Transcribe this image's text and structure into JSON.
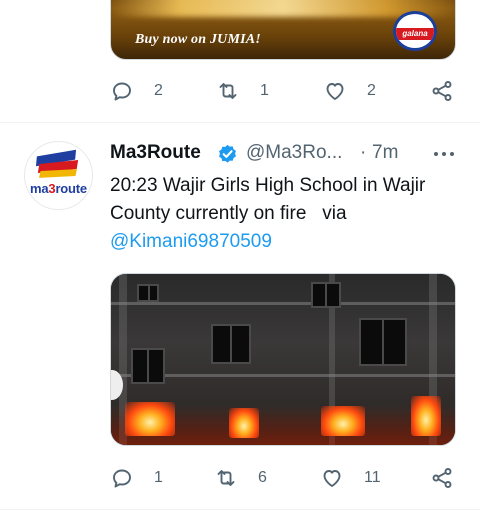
{
  "previous_tweet": {
    "media": {
      "promo_text": "Buy now on JUMIA!",
      "brand_logo_text": "galana"
    },
    "actions": {
      "reply_count": "2",
      "retweet_count": "1",
      "like_count": "2"
    }
  },
  "tweet": {
    "display_name": "Ma3Route",
    "handle": "@Ma3Ro...",
    "separator": "·",
    "time": "7m",
    "avatar": {
      "logo_text_prefix": "ma",
      "logo_text_three": "3",
      "logo_text_suffix": "route"
    },
    "text": "20:23 Wajir Girls High School in Wajir County currently on fire   via",
    "mention": "@Kimani69870509",
    "actions": {
      "reply_count": "1",
      "retweet_count": "6",
      "like_count": "11"
    }
  },
  "colors": {
    "accent": "#1d9bf0",
    "muted": "#536471",
    "text": "#0f1419",
    "divider": "#eff3f4"
  },
  "icons": [
    "reply-icon",
    "retweet-icon",
    "like-icon",
    "share-icon",
    "verified-badge-icon",
    "more-icon"
  ]
}
